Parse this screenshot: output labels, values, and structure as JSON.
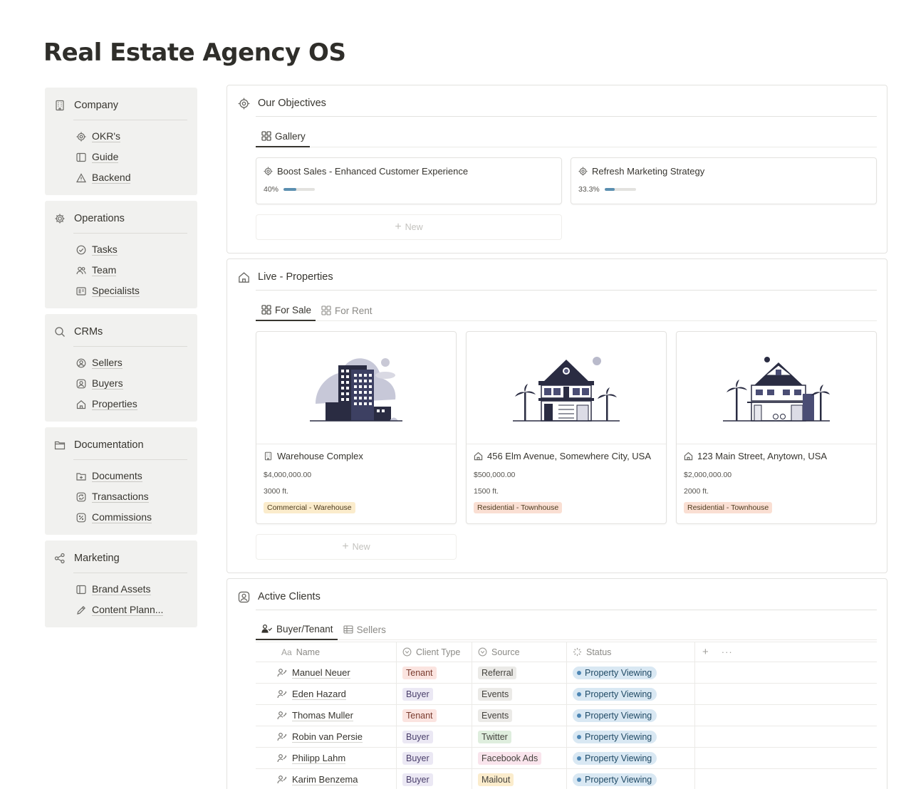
{
  "page": {
    "title": "Real Estate Agency OS"
  },
  "sidebar": {
    "groups": [
      {
        "title": "Company",
        "icon": "building-icon",
        "items": [
          {
            "label": "OKR's",
            "icon": "target-icon"
          },
          {
            "label": "Guide",
            "icon": "book-icon"
          },
          {
            "label": "Backend",
            "icon": "warning-icon"
          }
        ]
      },
      {
        "title": "Operations",
        "icon": "gear-icon",
        "items": [
          {
            "label": "Tasks",
            "icon": "check-circle-icon"
          },
          {
            "label": "Team",
            "icon": "people-icon"
          },
          {
            "label": "Specialists",
            "icon": "id-card-icon"
          }
        ]
      },
      {
        "title": "CRMs",
        "icon": "search-icon",
        "items": [
          {
            "label": "Sellers",
            "icon": "user-circle-icon"
          },
          {
            "label": "Buyers",
            "icon": "user-square-icon"
          },
          {
            "label": "Properties",
            "icon": "home-icon"
          }
        ]
      },
      {
        "title": "Documentation",
        "icon": "folder-icon",
        "items": [
          {
            "label": "Documents",
            "icon": "folder-plus-icon"
          },
          {
            "label": "Transactions",
            "icon": "refresh-icon"
          },
          {
            "label": "Commissions",
            "icon": "percent-icon"
          }
        ]
      },
      {
        "title": "Marketing",
        "icon": "share-icon",
        "items": [
          {
            "label": "Brand Assets",
            "icon": "book-icon"
          },
          {
            "label": "Content Plann...",
            "icon": "pencil-icon"
          }
        ]
      }
    ]
  },
  "objectives": {
    "title": "Our Objectives",
    "tab": "Gallery",
    "new_label": "New",
    "cards": [
      {
        "title": "Boost Sales - Enhanced Customer Experience",
        "progress_label": "40%",
        "progress": 0.4
      },
      {
        "title": "Refresh Marketing Strategy",
        "progress_label": "33.3%",
        "progress": 0.333
      }
    ]
  },
  "properties": {
    "title": "Live - Properties",
    "tabs": [
      "For Sale",
      "For Rent"
    ],
    "new_label": "New",
    "cards": [
      {
        "name": "Warehouse Complex",
        "price": "$4,000,000.00",
        "size": "3000 ft.",
        "tag": "Commercial - Warehouse",
        "tag_color": "#fbeccc",
        "icon": "building-icon"
      },
      {
        "name": "456 Elm Avenue, Somewhere City, USA",
        "price": "$500,000.00",
        "size": "1500 ft.",
        "tag": "Residential - Townhouse",
        "tag_color": "#fadfd3",
        "icon": "home-icon"
      },
      {
        "name": "123 Main Street, Anytown, USA",
        "price": "$2,000,000.00",
        "size": "2000 ft.",
        "tag": "Residential - Townhouse",
        "tag_color": "#fadfd3",
        "icon": "home-icon"
      }
    ]
  },
  "clients": {
    "title": "Active Clients",
    "tabs": [
      "Buyer/Tenant",
      "Sellers"
    ],
    "columns": {
      "name": "Name",
      "type": "Client Type",
      "source": "Source",
      "status": "Status",
      "add": "+",
      "more": "···",
      "name_icon": "Aa"
    },
    "rows": [
      {
        "name": "Manuel Neuer",
        "type": "Tenant",
        "source": "Referral",
        "status": "Property Viewing"
      },
      {
        "name": "Eden Hazard",
        "type": "Buyer",
        "source": "Events",
        "status": "Property Viewing"
      },
      {
        "name": "Thomas Muller",
        "type": "Tenant",
        "source": "Events",
        "status": "Property Viewing"
      },
      {
        "name": "Robin van Persie",
        "type": "Buyer",
        "source": "Twitter",
        "status": "Property Viewing"
      },
      {
        "name": "Philipp Lahm",
        "type": "Buyer",
        "source": "Facebook Ads",
        "status": "Property Viewing"
      },
      {
        "name": "Karim Benzema",
        "type": "Buyer",
        "source": "Mailout",
        "status": "Property Viewing"
      }
    ],
    "type_colors": {
      "Tenant": "#fbe4e0",
      "Buyer": "#ebe8f4"
    },
    "source_colors": {
      "Referral": "#ebeae7",
      "Events": "#ebeae7",
      "Twitter": "#dfeede",
      "Facebook Ads": "#f9e4ec",
      "Mailout": "#fbeccc"
    }
  },
  "colors": {
    "accent": "#5b8fb0",
    "status_bg": "#d9e8f3"
  }
}
